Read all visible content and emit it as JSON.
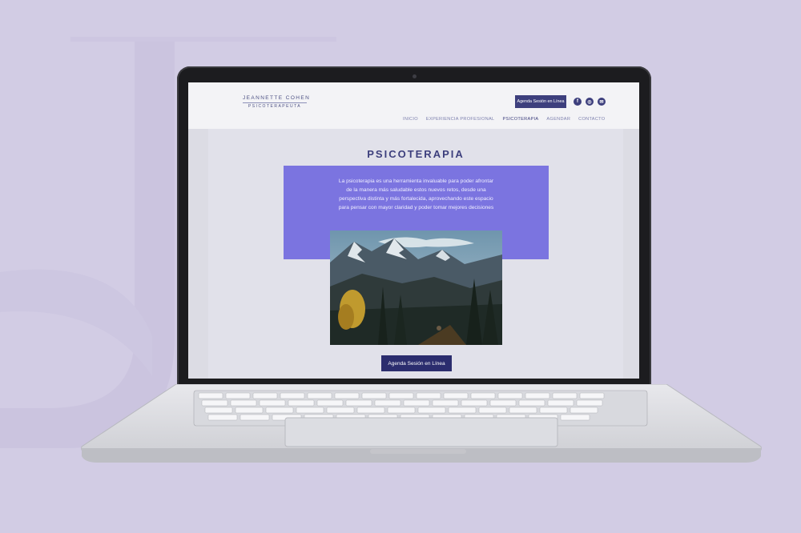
{
  "site": {
    "logo_name": "JEANNETTE COHEN",
    "logo_subtitle": "PSICOTERAPEUTA",
    "header_button": "Agenda Sesión en Línea",
    "social": [
      {
        "icon": "facebook-icon",
        "glyph": "f"
      },
      {
        "icon": "instagram-icon",
        "glyph": "◎"
      },
      {
        "icon": "email-icon",
        "glyph": "✉"
      }
    ],
    "nav": [
      {
        "label": "INICIO",
        "active": false
      },
      {
        "label": "EXPERIENCIA PROFESIONAL",
        "active": false
      },
      {
        "label": "PSICOTERAPIA",
        "active": true
      },
      {
        "label": "AGENDAR",
        "active": false
      },
      {
        "label": "CONTACTO",
        "active": false
      }
    ]
  },
  "page": {
    "title": "PSICOTERAPIA",
    "intro": "La psicoterapia es una herramienta invaluable para poder afrontar de la manera más saludable estos nuevos retos, desde una perspectiva distinta y más fortalecida, aprovechando este espacio para pensar con mayor claridad y poder tomar mejores decisiones",
    "cta_button": "Agenda Sesión en Línea"
  },
  "colors": {
    "background": "#d2cce4",
    "brand_dark": "#3d3f7d",
    "violet": "#7b74e0"
  }
}
